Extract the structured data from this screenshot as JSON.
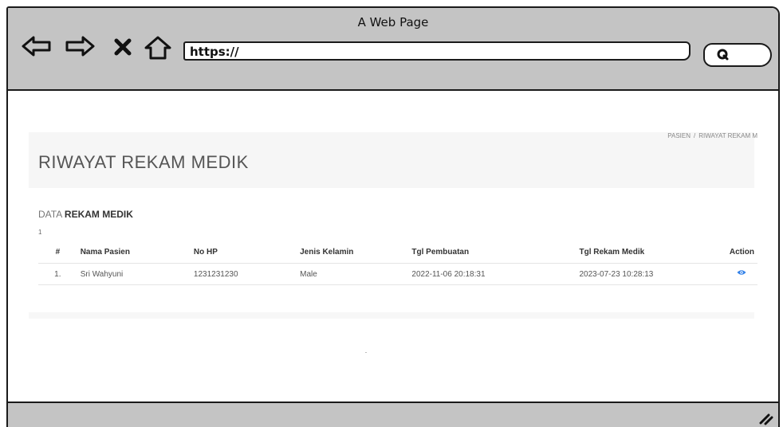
{
  "window": {
    "title": "A Web Page"
  },
  "toolbar": {
    "back_icon": "back-arrow-icon",
    "forward_icon": "forward-arrow-icon",
    "stop_icon": "close-x-icon",
    "home_icon": "home-icon",
    "url": "https://",
    "search_icon": "search-icon"
  },
  "header": {
    "title": "RIWAYAT REKAM MEDIK",
    "breadcrumb": [
      "PASIEN",
      "RIWAYAT REKAM M"
    ]
  },
  "main": {
    "data_label_prefix": "DATA",
    "data_label_bold": "REKAM MEDIK",
    "page_indicator": "1",
    "table": {
      "columns": [
        "#",
        "Nama Pasien",
        "No HP",
        "Jenis Kelamin",
        "Tgl Pembuatan",
        "Tgl Rekam Medik",
        "Action"
      ],
      "rows": [
        {
          "no": "1.",
          "nama": "Sri Wahyuni",
          "hp": "1231231230",
          "jk": "Male",
          "tgl_pembuatan": "2022-11-06 20:18:31",
          "tgl_rekam": "2023-07-23 10:28:13",
          "action_icon": "eye-icon"
        }
      ]
    }
  },
  "colors": {
    "chrome": "#c4c4c4",
    "accent": "#2f7fe8"
  }
}
